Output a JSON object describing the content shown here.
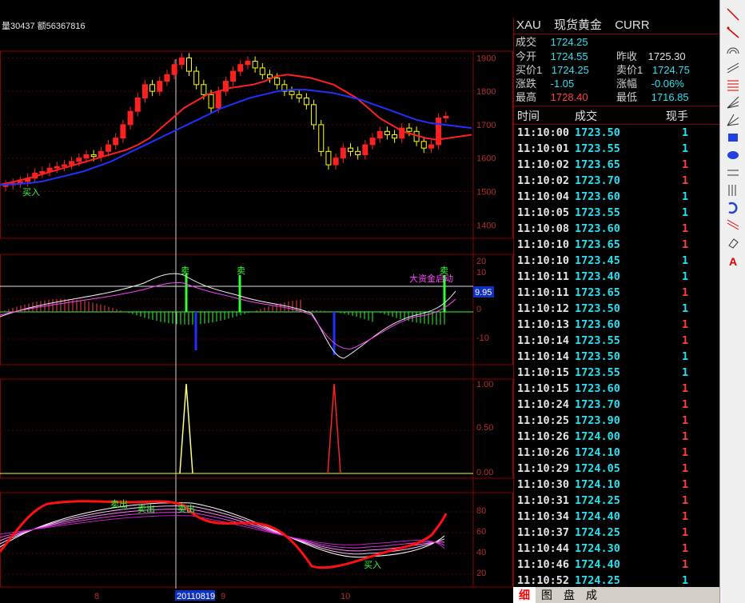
{
  "info_bar": {
    "volume_text": "量30437 额56367816"
  },
  "quote": {
    "symbol": "XAU",
    "name": "现货黄金",
    "currency": "CURR",
    "deal_label": "成交",
    "deal_value": "1724.25",
    "open_label": "今开",
    "open_value": "1724.55",
    "prev_close_label": "昨收",
    "prev_close_value": "1725.30",
    "bid_label": "买价1",
    "bid_value": "1724.25",
    "ask_label": "卖价1",
    "ask_value": "1724.75",
    "change_label": "涨跌",
    "change_value": "-1.05",
    "change_pct_label": "涨幅",
    "change_pct_value": "-0.06%",
    "high_label": "最高",
    "high_value": "1728.40",
    "low_label": "最低",
    "low_value": "1716.85"
  },
  "tick_headers": {
    "time": "时间",
    "price": "成交",
    "volume": "现手"
  },
  "ticks": [
    {
      "time": "11:10:00",
      "price": "1723.50",
      "vol": "1"
    },
    {
      "time": "11:10:01",
      "price": "1723.55",
      "vol": "1"
    },
    {
      "time": "11:10:02",
      "price": "1723.65",
      "vol": "1"
    },
    {
      "time": "11:10:02",
      "price": "1723.70",
      "vol": "1"
    },
    {
      "time": "11:10:04",
      "price": "1723.60",
      "vol": "1"
    },
    {
      "time": "11:10:05",
      "price": "1723.55",
      "vol": "1"
    },
    {
      "time": "11:10:08",
      "price": "1723.60",
      "vol": "1"
    },
    {
      "time": "11:10:10",
      "price": "1723.65",
      "vol": "1"
    },
    {
      "time": "11:10:10",
      "price": "1723.45",
      "vol": "1"
    },
    {
      "time": "11:10:11",
      "price": "1723.40",
      "vol": "1"
    },
    {
      "time": "11:10:11",
      "price": "1723.65",
      "vol": "1"
    },
    {
      "time": "11:10:12",
      "price": "1723.50",
      "vol": "1"
    },
    {
      "time": "11:10:13",
      "price": "1723.60",
      "vol": "1"
    },
    {
      "time": "11:10:14",
      "price": "1723.55",
      "vol": "1"
    },
    {
      "time": "11:10:14",
      "price": "1723.50",
      "vol": "1"
    },
    {
      "time": "11:10:15",
      "price": "1723.55",
      "vol": "1"
    },
    {
      "time": "11:10:15",
      "price": "1723.60",
      "vol": "1"
    },
    {
      "time": "11:10:24",
      "price": "1723.70",
      "vol": "1"
    },
    {
      "time": "11:10:25",
      "price": "1723.90",
      "vol": "1"
    },
    {
      "time": "11:10:26",
      "price": "1724.00",
      "vol": "1"
    },
    {
      "time": "11:10:26",
      "price": "1724.10",
      "vol": "1"
    },
    {
      "time": "11:10:29",
      "price": "1724.05",
      "vol": "1"
    },
    {
      "time": "11:10:30",
      "price": "1724.10",
      "vol": "1"
    },
    {
      "time": "11:10:31",
      "price": "1724.25",
      "vol": "1"
    },
    {
      "time": "11:10:34",
      "price": "1724.40",
      "vol": "1"
    },
    {
      "time": "11:10:37",
      "price": "1724.25",
      "vol": "1"
    },
    {
      "time": "11:10:44",
      "price": "1724.30",
      "vol": "1"
    },
    {
      "time": "11:10:46",
      "price": "1724.40",
      "vol": "1"
    },
    {
      "time": "11:10:52",
      "price": "1724.25",
      "vol": "1"
    }
  ],
  "tick_vol_colors": [
    "c",
    "c",
    "r",
    "r",
    "c",
    "c",
    "r",
    "r",
    "c",
    "c",
    "r",
    "c",
    "r",
    "r",
    "c",
    "c",
    "r",
    "r",
    "r",
    "r",
    "r",
    "r",
    "r",
    "r",
    "r",
    "r",
    "r",
    "r",
    "c"
  ],
  "bottom_tabs": [
    "细",
    "图",
    "盘",
    "成"
  ],
  "chart_labels": {
    "price_axis": [
      "1900",
      "1800",
      "1700",
      "1600",
      "1500",
      "1400"
    ],
    "macd_axis": [
      "20",
      "10",
      "0",
      "-10"
    ],
    "macd_value": "9.95",
    "peak_axis": [
      "1.00",
      "0.50",
      "0.00"
    ],
    "kdj_axis": [
      "80",
      "60",
      "40",
      "20"
    ],
    "buy_label": "买入",
    "sell_label": "卖",
    "sell_out_label": "卖出",
    "big_money_label": "大资金启动",
    "x_ticks": [
      "8",
      "20110819",
      "9",
      "10"
    ]
  },
  "chart_data": {
    "type": "candlestick",
    "title": "",
    "price_series": [
      1520,
      1525,
      1530,
      1540,
      1555,
      1560,
      1570,
      1575,
      1580,
      1590,
      1600,
      1610,
      1605,
      1620,
      1640,
      1660,
      1700,
      1740,
      1780,
      1820,
      1800,
      1830,
      1850,
      1880,
      1900,
      1860,
      1820,
      1790,
      1750,
      1800,
      1830,
      1860,
      1880,
      1890,
      1870,
      1850,
      1840,
      1820,
      1800,
      1790,
      1780,
      1760,
      1700,
      1620,
      1580,
      1600,
      1630,
      1620,
      1610,
      1640,
      1660,
      1680,
      1670,
      1660,
      1690,
      1680,
      1650,
      1630,
      1640,
      1720,
      1725
    ],
    "ma_fast": [
      1520,
      1528,
      1536,
      1545,
      1555,
      1565,
      1575,
      1585,
      1595,
      1605,
      1615,
      1625,
      1640,
      1660,
      1690,
      1720,
      1750,
      1770,
      1790,
      1800,
      1810,
      1815,
      1820,
      1830,
      1845,
      1850,
      1845,
      1840,
      1830,
      1820,
      1800,
      1780,
      1750,
      1720,
      1700,
      1680,
      1670,
      1660,
      1655,
      1660,
      1665,
      1670
    ],
    "ma_slow": [
      1520,
      1522,
      1525,
      1530,
      1540,
      1550,
      1560,
      1575,
      1590,
      1610,
      1630,
      1650,
      1670,
      1690,
      1710,
      1730,
      1750,
      1765,
      1780,
      1790,
      1800,
      1805,
      1805,
      1800,
      1795,
      1785,
      1775,
      1760,
      1745,
      1730,
      1715,
      1705,
      1700,
      1695,
      1690
    ]
  }
}
